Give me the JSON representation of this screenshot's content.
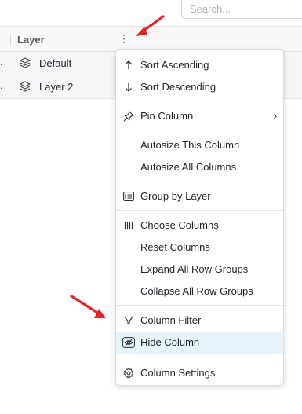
{
  "search": {
    "placeholder": "Search..."
  },
  "header": {
    "column_title": "Layer",
    "menu_glyph": "⋮"
  },
  "rows": [
    {
      "prefix": ".",
      "label": "Default"
    },
    {
      "prefix": ".",
      "label": "Layer 2"
    }
  ],
  "menu": {
    "items": [
      {
        "label": "Sort Ascending",
        "icon": "arrow-up-icon"
      },
      {
        "label": "Sort Descending",
        "icon": "arrow-down-icon"
      },
      {
        "label": "Pin Column",
        "icon": "pin-icon",
        "submenu": true
      },
      {
        "label": "Autosize This Column"
      },
      {
        "label": "Autosize All Columns"
      },
      {
        "label": "Group by Layer",
        "icon": "group-icon"
      },
      {
        "label": "Choose Columns",
        "icon": "columns-icon"
      },
      {
        "label": "Reset Columns"
      },
      {
        "label": "Expand All Row Groups"
      },
      {
        "label": "Collapse All Row Groups"
      },
      {
        "label": "Column Filter",
        "icon": "filter-icon"
      },
      {
        "label": "Hide Column",
        "icon": "eye-off-icon",
        "highlighted": true
      },
      {
        "label": "Column Settings",
        "icon": "gear-icon"
      }
    ],
    "submenu_glyph": "›"
  },
  "colors": {
    "highlight": "#e8f4fb",
    "arrow": "#e0262a"
  }
}
